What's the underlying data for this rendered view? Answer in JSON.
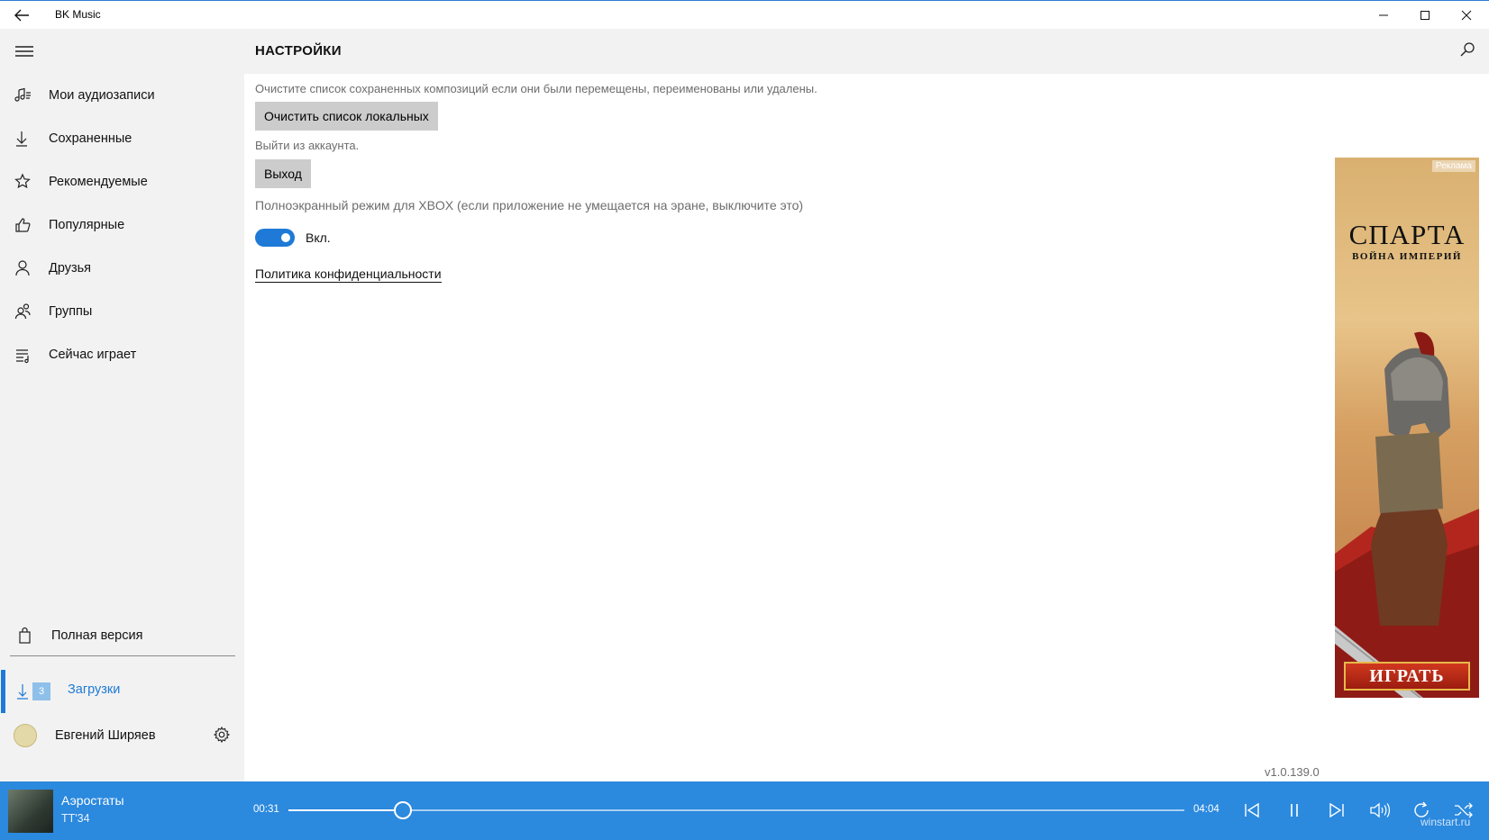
{
  "window": {
    "title": "BK Music"
  },
  "sidebar": {
    "items": [
      {
        "label": "Мои аудиозаписи",
        "icon": "music-notes-icon"
      },
      {
        "label": "Сохраненные",
        "icon": "download-arrow-icon"
      },
      {
        "label": "Рекомендуемые",
        "icon": "star-icon"
      },
      {
        "label": "Популярные",
        "icon": "thumbs-up-icon"
      },
      {
        "label": "Друзья",
        "icon": "person-icon"
      },
      {
        "label": "Группы",
        "icon": "people-icon"
      },
      {
        "label": "Сейчас играет",
        "icon": "playlist-icon"
      }
    ],
    "full_version": "Полная версия",
    "downloads": {
      "label": "Загрузки",
      "count": "3"
    },
    "user": {
      "name": "Евгений Ширяев"
    }
  },
  "header": {
    "title": "НАСТРОЙКИ"
  },
  "settings": {
    "clear_hint": "Очистите список сохраненных композиций если они были перемещены, переименованы или удалены.",
    "clear_button": "Очистить список локальных",
    "logout_hint": "Выйти из аккаунта.",
    "logout_button": "Выход",
    "xbox_hint": "Полноэкранный режим для XBOX (если приложение не умещается на эране, выключите это)",
    "xbox_toggle_label": "Вкл.",
    "xbox_toggle_on": true,
    "privacy_link": "Политика конфиденциальности"
  },
  "ad": {
    "tag": "Реклама",
    "title": "СПАРТА",
    "subtitle": "ВОЙНА ИМПЕРИЙ",
    "cta": "ИГРАТЬ"
  },
  "version": "v1.0.139.0",
  "player": {
    "track": "Аэростаты",
    "artist": "ТТ'34",
    "current_time": "00:31",
    "total_time": "04:04",
    "progress": 0.128
  },
  "watermark": "winstart.ru",
  "colors": {
    "accent": "#1e7ad6",
    "player_bg": "#2b89de",
    "sidebar_bg": "#f2f2f2"
  }
}
